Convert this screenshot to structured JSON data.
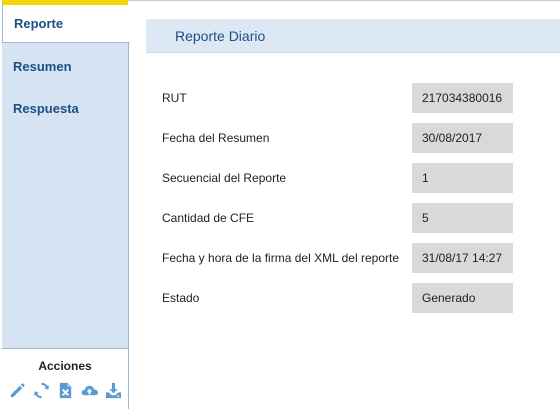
{
  "sidebar": {
    "tabs": [
      {
        "label": "Reporte",
        "active": true
      },
      {
        "label": "Resumen",
        "active": false
      },
      {
        "label": "Respuesta",
        "active": false
      }
    ],
    "actions": {
      "title": "Acciones",
      "icons": [
        "edit-icon",
        "refresh-icon",
        "delete-file-icon",
        "cloud-upload-icon",
        "download-icon"
      ]
    }
  },
  "panel": {
    "title": "Reporte Diario",
    "fields": [
      {
        "label": "RUT",
        "value": "217034380016"
      },
      {
        "label": "Fecha del Resumen",
        "value": "30/08/2017"
      },
      {
        "label": "Secuencial del Reporte",
        "value": "1"
      },
      {
        "label": "Cantidad de CFE",
        "value": "5"
      },
      {
        "label": "Fecha y hora de la firma del XML del reporte",
        "value": "31/08/17 14:27"
      },
      {
        "label": "Estado",
        "value": "Generado"
      }
    ]
  },
  "colors": {
    "accent": "#1e4f84",
    "icon": "#5b9bd5",
    "sidebar_bg": "#d6e3f2",
    "header_bg": "#dde8f5",
    "value_bg": "#d9d9d9",
    "tab_top_accent": "#f5d600"
  }
}
